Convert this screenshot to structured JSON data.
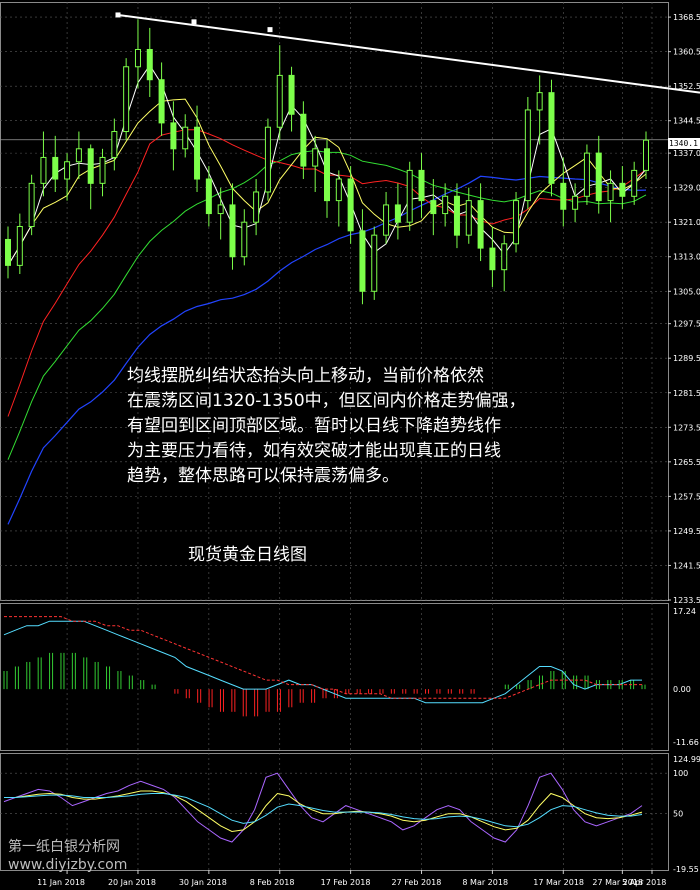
{
  "annotation": {
    "lines": [
      "均线摆脱纠结状态抬头向上移动，当前价格依然",
      "在震荡区间1320-1350中，但区间内价格走势偏强，",
      "有望回到区间顶部区域。暂时以日线下降趋势线作",
      "为主要压力看待，如有效突破才能出现真正的日线",
      "趋势，整体思路可以保持震荡偏多。"
    ],
    "caption": "现货黄金日线图"
  },
  "watermark": {
    "line1": "第一纸白银分析网",
    "line2": "www.diyizby.com"
  },
  "current_price_label": "1340.1",
  "chart_data": [
    {
      "type": "candlestick",
      "panel": "main",
      "y_ticks": [
        "1368.5",
        "1360.5",
        "1352.5",
        "1344.5",
        "1337.0",
        "1329.0",
        "1321.0",
        "1313.0",
        "1305.0",
        "1297.5",
        "1289.5",
        "1281.5",
        "1273.5",
        "1265.5",
        "1257.5",
        "1249.5",
        "1241.5",
        "1233.5"
      ],
      "ylim": [
        1233.5,
        1372
      ],
      "current_price": 1340.1,
      "colors": {
        "candle": "#7dff4a",
        "trendline": "#ffffff",
        "ma_fast": "#ffffff",
        "ma_med": "#ffff66",
        "ma_red": "#ff2222",
        "ma_green": "#33dd33",
        "ma_blue": "#2244ff",
        "grid": "#5a5a5a"
      },
      "candles": [
        [
          1317,
          1320,
          1308,
          1311
        ],
        [
          1311,
          1323,
          1309,
          1320
        ],
        [
          1320,
          1332,
          1318,
          1330
        ],
        [
          1330,
          1342,
          1327,
          1336
        ],
        [
          1336,
          1341,
          1328,
          1331
        ],
        [
          1331,
          1337,
          1326,
          1335
        ],
        [
          1335,
          1342,
          1331,
          1338
        ],
        [
          1338,
          1339,
          1324,
          1330
        ],
        [
          1330,
          1338,
          1327,
          1336
        ],
        [
          1336,
          1345,
          1333,
          1342
        ],
        [
          1342,
          1359,
          1340,
          1357
        ],
        [
          1357,
          1368,
          1352,
          1361
        ],
        [
          1361,
          1366,
          1350,
          1354
        ],
        [
          1354,
          1358,
          1341,
          1344
        ],
        [
          1344,
          1349,
          1333,
          1338
        ],
        [
          1338,
          1346,
          1336,
          1343
        ],
        [
          1343,
          1348,
          1328,
          1331
        ],
        [
          1331,
          1334,
          1320,
          1323
        ],
        [
          1323,
          1329,
          1317,
          1325
        ],
        [
          1325,
          1330,
          1310,
          1313
        ],
        [
          1313,
          1324,
          1311,
          1321
        ],
        [
          1321,
          1331,
          1318,
          1328
        ],
        [
          1328,
          1345,
          1326,
          1343
        ],
        [
          1343,
          1362,
          1340,
          1355
        ],
        [
          1355,
          1357,
          1342,
          1346
        ],
        [
          1346,
          1349,
          1331,
          1334
        ],
        [
          1334,
          1341,
          1328,
          1338
        ],
        [
          1338,
          1340,
          1322,
          1326
        ],
        [
          1326,
          1333,
          1320,
          1331
        ],
        [
          1331,
          1334,
          1316,
          1319
        ],
        [
          1319,
          1324,
          1302,
          1305
        ],
        [
          1305,
          1320,
          1303,
          1318
        ],
        [
          1318,
          1328,
          1316,
          1325
        ],
        [
          1325,
          1330,
          1317,
          1321
        ],
        [
          1321,
          1335,
          1319,
          1333
        ],
        [
          1333,
          1337,
          1322,
          1326
        ],
        [
          1326,
          1331,
          1318,
          1323
        ],
        [
          1323,
          1330,
          1320,
          1327
        ],
        [
          1327,
          1330,
          1315,
          1318
        ],
        [
          1318,
          1329,
          1316,
          1326
        ],
        [
          1326,
          1330,
          1312,
          1315
        ],
        [
          1315,
          1320,
          1306,
          1310
        ],
        [
          1310,
          1318,
          1305,
          1316
        ],
        [
          1316,
          1328,
          1314,
          1326
        ],
        [
          1326,
          1350,
          1324,
          1347
        ],
        [
          1347,
          1355,
          1339,
          1351
        ],
        [
          1351,
          1354,
          1327,
          1330
        ],
        [
          1330,
          1336,
          1320,
          1324
        ],
        [
          1324,
          1330,
          1321,
          1327
        ],
        [
          1327,
          1339,
          1325,
          1337
        ],
        [
          1337,
          1341,
          1323,
          1326
        ],
        [
          1326,
          1333,
          1321,
          1330
        ],
        [
          1330,
          1334,
          1324,
          1327
        ],
        [
          1327,
          1335,
          1325,
          1333
        ],
        [
          1333,
          1342,
          1331,
          1340
        ]
      ],
      "trendline": [
        [
          14,
          1369
        ],
        [
          96,
          1351
        ]
      ]
    },
    {
      "type": "line",
      "panel": "macd",
      "y_ticks": [
        "17.24",
        "0.00",
        "-11.66"
      ],
      "ylim": [
        -11.66,
        17.24
      ],
      "colors": {
        "histogram_pos": "#33cc33",
        "histogram_neg": "#ff2222",
        "main": "#55ddff",
        "signal": "#ff3333"
      },
      "histogram": [
        4,
        5,
        6,
        7,
        8,
        8,
        8,
        7,
        6,
        5,
        4,
        3,
        2,
        1,
        0,
        -1,
        -2,
        -3,
        -4,
        -5,
        -5,
        -6,
        -6,
        -5,
        -5,
        -4,
        -3,
        -3,
        -2,
        -2,
        -1,
        -1,
        -1,
        -1,
        -1,
        -1,
        -1,
        -1,
        -1,
        -1,
        -1,
        -1,
        0,
        0,
        1,
        1,
        2,
        3,
        4,
        4,
        3,
        3,
        2,
        2,
        2,
        2,
        1
      ],
      "main": [
        12,
        13,
        14,
        14,
        15,
        15,
        15,
        15,
        14,
        13,
        12,
        11,
        10,
        9,
        8,
        7,
        5,
        4,
        3,
        2,
        1,
        0,
        0,
        0,
        1,
        2,
        1,
        1,
        0,
        -1,
        -2,
        -2,
        -2,
        -2,
        -2,
        -2,
        -2,
        -3,
        -3,
        -3,
        -3,
        -3,
        -3,
        -2,
        -1,
        1,
        3,
        5,
        5,
        4,
        1,
        0,
        1,
        1,
        1,
        2,
        2
      ],
      "signal": [
        16,
        16,
        16,
        16,
        16,
        16,
        15,
        15,
        15,
        14,
        14,
        13,
        13,
        12,
        11,
        10,
        9,
        8,
        7,
        6,
        5,
        4,
        3,
        2,
        2,
        1,
        1,
        1,
        0,
        0,
        -1,
        -1,
        -1,
        -1,
        -2,
        -2,
        -2,
        -2,
        -2,
        -2,
        -2,
        -2,
        -2,
        -2,
        -2,
        -1,
        0,
        1,
        2,
        2,
        2,
        2,
        1,
        1,
        1,
        1,
        1
      ]
    },
    {
      "type": "line",
      "panel": "oscillator",
      "y_ticks": [
        "124.99",
        "100",
        "50",
        "-19.55"
      ],
      "ylim": [
        -19.55,
        124.99
      ],
      "colors": {
        "fast": "#aa66ff",
        "slow": "#ffff66",
        "signal": "#55ddff"
      },
      "fast": [
        65,
        70,
        75,
        80,
        78,
        70,
        60,
        65,
        70,
        75,
        78,
        85,
        90,
        85,
        80,
        70,
        55,
        40,
        30,
        20,
        15,
        30,
        55,
        95,
        100,
        80,
        60,
        45,
        40,
        50,
        60,
        55,
        50,
        45,
        40,
        30,
        35,
        45,
        55,
        60,
        55,
        40,
        30,
        20,
        15,
        30,
        60,
        95,
        100,
        80,
        55,
        40,
        35,
        40,
        45,
        50,
        60
      ],
      "slow": [
        70,
        70,
        72,
        74,
        75,
        74,
        70,
        68,
        68,
        70,
        72,
        75,
        78,
        78,
        76,
        72,
        65,
        55,
        45,
        35,
        28,
        30,
        40,
        60,
        75,
        72,
        62,
        55,
        50,
        50,
        52,
        53,
        52,
        50,
        47,
        42,
        40,
        42,
        46,
        50,
        50,
        46,
        40,
        34,
        30,
        32,
        42,
        60,
        75,
        70,
        60,
        50,
        45,
        44,
        45,
        48,
        52
      ],
      "signal": [
        70,
        70,
        71,
        72,
        73,
        73,
        72,
        70,
        70,
        70,
        71,
        72,
        74,
        75,
        75,
        73,
        70,
        64,
        58,
        50,
        42,
        38,
        40,
        48,
        58,
        62,
        60,
        57,
        54,
        52,
        52,
        52,
        52,
        51,
        49,
        46,
        44,
        43,
        44,
        46,
        47,
        46,
        43,
        39,
        35,
        34,
        37,
        45,
        55,
        60,
        59,
        55,
        51,
        48,
        47,
        47,
        49
      ]
    }
  ],
  "date_labels": [
    "11 Jan 2018",
    "20 Jan 2018",
    "30 Jan 2018",
    "8 Feb 2018",
    "17 Feb 2018",
    "27 Feb 2018",
    "8 Mar 2018",
    "17 Mar 2018",
    "27 Mar 2018",
    "5 Apr 2018"
  ]
}
